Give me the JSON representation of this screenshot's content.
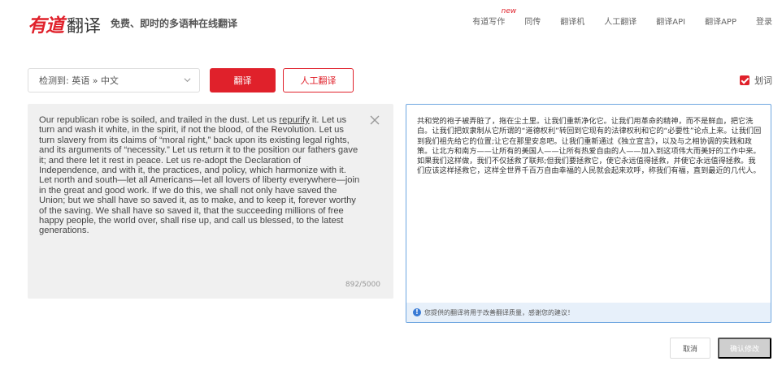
{
  "header": {
    "logo_youdao": "有道",
    "logo_fanyi": "翻译",
    "slogan": "免费、即时的多语种在线翻译",
    "nav": [
      {
        "label": "有道写作",
        "badge": "new"
      },
      {
        "label": "同传"
      },
      {
        "label": "翻译机"
      },
      {
        "label": "人工翻译"
      },
      {
        "label": "翻译API"
      },
      {
        "label": "翻译APP"
      },
      {
        "label": "登录"
      }
    ]
  },
  "toolbar": {
    "lang_detect": "检测到: 英语 » 中文",
    "translate_label": "翻译",
    "human_translate_label": "人工翻译",
    "huaci_label": "划词",
    "huaci_checked": true
  },
  "source": {
    "text_before": "Our republican robe is soiled, and trailed in the dust. Let us ",
    "text_underlined": "repurify",
    "text_after": " it. Let us turn and wash it white, in the spirit, if not the blood, of the Revolution. Let us turn slavery from its claims of “moral right,” back upon its existing legal rights, and its arguments of “necessity.” Let us return it to the position our fathers gave it; and there let it rest in peace. Let us re-adopt the Declaration of Independence, and with it, the practices, and policy, which harmonize with it. Let north and south—let all Americans—let all lovers of liberty everywhere—join in the great and good work. If we do this, we shall not only have saved the Union; but we shall have so saved it, as to make, and to keep it, forever worthy of the saving. We shall have so saved it, that the succeeding millions of free happy people, the world over, shall rise up, and call us blessed, to the latest generations.",
    "char_count": "892/5000"
  },
  "target": {
    "text": "共和党的袍子被弄脏了，拖在尘土里。让我们重新净化它。让我们用革命的精神，而不是鲜血，把它洗白。让我们把奴隶制从它所谓的“道德权利”转回到它现有的法律权利和它的“必要性”论点上来。让我们回到我们祖先给它的位置;让它在那里安息吧。让我们重新通过《独立宣言》，以及与之相协调的实践和政策。让北方和南方——让所有的美国人——让所有热爱自由的人——加入到这项伟大而美好的工作中来。如果我们这样做，我们不仅拯救了联邦;但我们要拯救它，使它永远值得拯救，并使它永远值得拯救。我们应该这样拯救它，这样全世界千百万自由幸福的人民就会起来欢呼，称我们有福，直到最近的几代人。",
    "notice": "您提供的翻译将用于改善翻译质量，感谢您的建议！"
  },
  "actions": {
    "cancel_label": "取消",
    "confirm_label": "确认修改"
  },
  "colors": {
    "brand_red": "#e0212b",
    "panel_gray": "#f0f0f0",
    "target_border": "#6ea6e0",
    "notice_bg": "#e7f0fa"
  }
}
